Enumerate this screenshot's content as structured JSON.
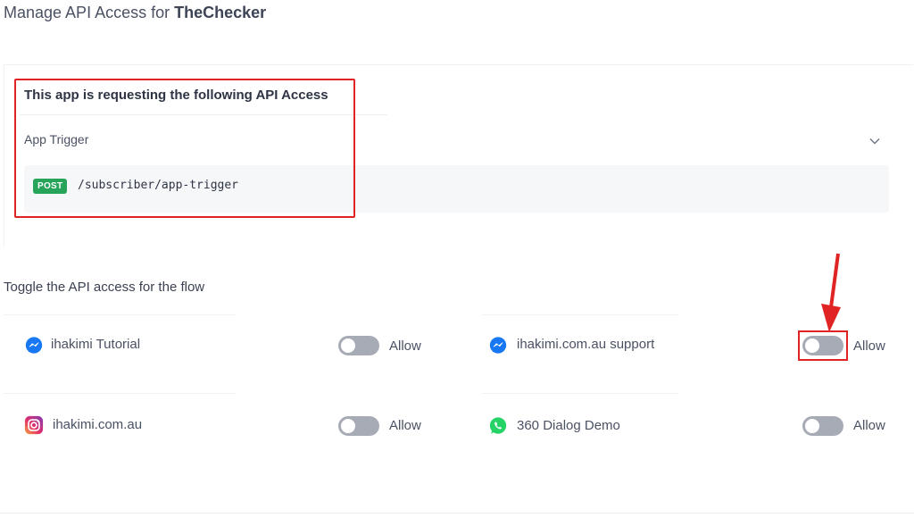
{
  "header": {
    "title_prefix": "Manage API Access for",
    "app_name": "TheChecker"
  },
  "request": {
    "heading": "This app is requesting the following API Access",
    "trigger_label": "App Trigger",
    "method": "POST",
    "path": "/subscriber/app-trigger"
  },
  "flows": {
    "title": "Toggle the API access for the flow",
    "items": [
      {
        "name": "ihakimi Tutorial",
        "channel": "messenger-icon",
        "allowed": false,
        "allow_label": "Allow"
      },
      {
        "name": "ihakimi.com.au support",
        "channel": "messenger-icon",
        "allowed": false,
        "allow_label": "Allow"
      },
      {
        "name": "ihakimi.com.au",
        "channel": "instagram-icon",
        "allowed": false,
        "allow_label": "Allow"
      },
      {
        "name": "360 Dialog Demo",
        "channel": "whatsapp-icon",
        "allowed": false,
        "allow_label": "Allow"
      }
    ]
  },
  "colors": {
    "highlight": "#e02424",
    "post_badge": "#26a55a",
    "toggle_off": "#a6abb5",
    "messenger": "#1877f2",
    "whatsapp": "#25d366"
  }
}
